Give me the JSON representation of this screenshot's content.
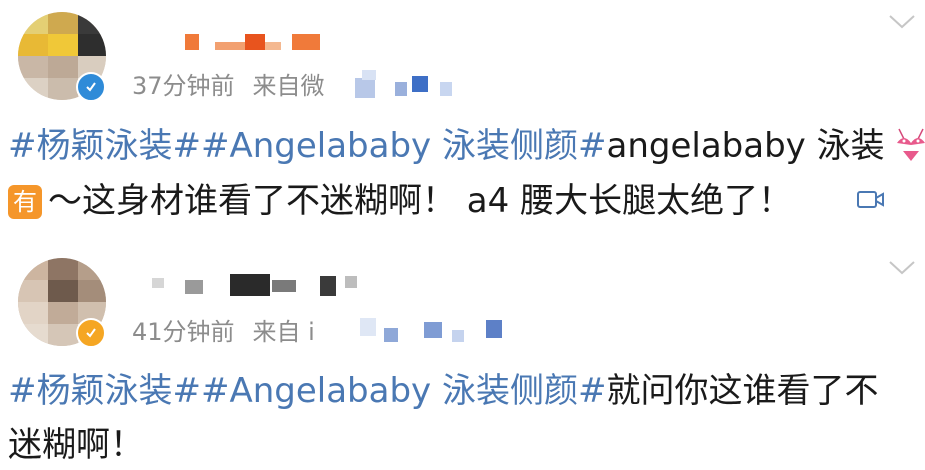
{
  "colors": {
    "topic": "#4a78b3",
    "text": "#1a1a1a",
    "meta": "#8c8c8c",
    "verified_blue": "#2f8bd8",
    "verified_gold": "#f5a623",
    "you_badge": "#f5962a"
  },
  "posts": [
    {
      "time": "37分钟前",
      "source_prefix": "来自微",
      "verified": "blue",
      "topic_1": "#杨颖泳装#",
      "topic_2": "#Angelababy 泳装侧颜#",
      "line1_tail": "angelababy 泳装",
      "emoji_name": "bikini-emoji-icon",
      "badge_label": "有",
      "line2_text": "～这身材谁看了不迷糊啊！ a4 腰大长腿太绝了！",
      "video_icon": "video-link-icon"
    },
    {
      "time": "41分钟前",
      "source_prefix": "来自 i",
      "verified": "gold",
      "topic_1": "#杨颖泳装#",
      "topic_2": "#Angelababy 泳装侧颜#",
      "line1_tail": "就问你这谁看了不",
      "line2_text": "迷糊啊！"
    }
  ]
}
